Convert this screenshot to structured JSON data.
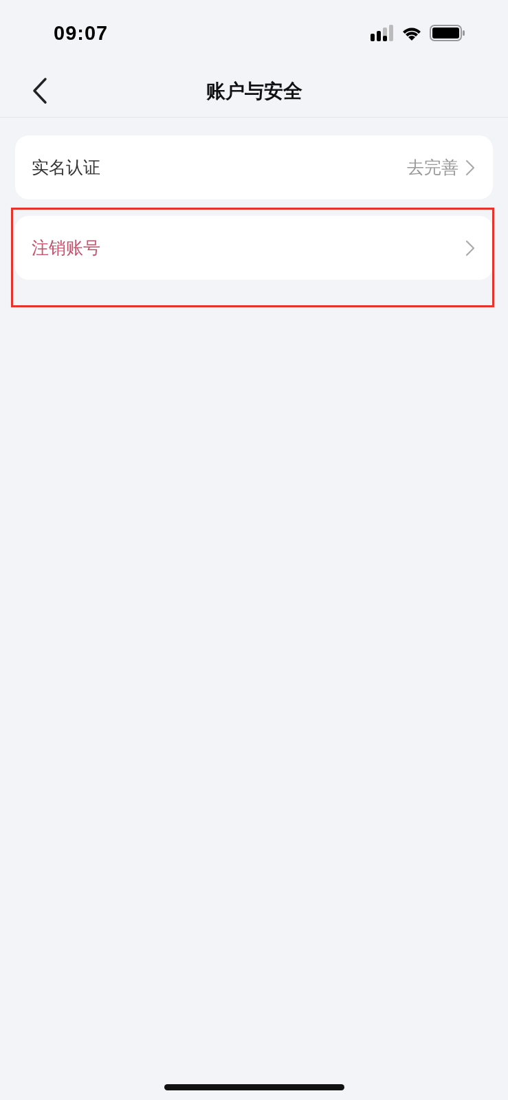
{
  "status_bar": {
    "time": "09:07"
  },
  "header": {
    "title": "账户与安全"
  },
  "items": [
    {
      "label": "实名认证",
      "value": "去完善",
      "kind": "normal"
    },
    {
      "label": "注销账号",
      "kind": "danger"
    }
  ]
}
